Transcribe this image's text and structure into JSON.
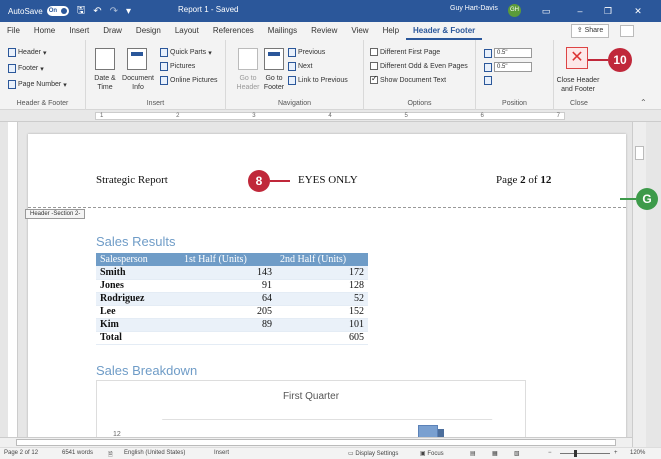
{
  "titlebar": {
    "autosave_label": "AutoSave",
    "autosave_state": "On",
    "doc_title": "Report 1 - Saved",
    "user_name": "Guy Hart-Davis",
    "user_initials": "GH",
    "brand_color": "#2b579a"
  },
  "tabs": [
    {
      "label": "File"
    },
    {
      "label": "Home"
    },
    {
      "label": "Insert"
    },
    {
      "label": "Draw"
    },
    {
      "label": "Design"
    },
    {
      "label": "Layout"
    },
    {
      "label": "References"
    },
    {
      "label": "Mailings"
    },
    {
      "label": "Review"
    },
    {
      "label": "View"
    },
    {
      "label": "Help"
    },
    {
      "label": "Header & Footer"
    }
  ],
  "active_tab": "Header & Footer",
  "share_label": "Share",
  "ribbon": {
    "header_footer": {
      "header": "Header",
      "footer": "Footer",
      "page_number": "Page Number",
      "group": "Header & Footer"
    },
    "insert": {
      "date_time": "Date &\nTime",
      "document_info": "Document\nInfo",
      "quick_parts": "Quick Parts",
      "pictures": "Pictures",
      "online_pictures": "Online Pictures",
      "group": "Insert"
    },
    "navigation": {
      "go_to_header": "Go to\nHeader",
      "go_to_footer": "Go to\nFooter",
      "previous": "Previous",
      "next": "Next",
      "link_to_previous": "Link to Previous",
      "group": "Navigation"
    },
    "options": {
      "different_first_page": "Different First Page",
      "different_odd_even": "Different Odd & Even Pages",
      "show_document_text": "Show Document Text",
      "show_document_text_checked": true,
      "group": "Options"
    },
    "position": {
      "header_from_top": "0.5\"",
      "footer_from_bottom": "0.5\"",
      "group": "Position"
    },
    "close": {
      "close_label": "Close Header\nand Footer",
      "group": "Close"
    }
  },
  "ruler_marks": [
    "1",
    "2",
    "3",
    "4",
    "5",
    "6",
    "7"
  ],
  "document": {
    "header_left": "Strategic Report",
    "header_center": "EYES ONLY",
    "header_page_prefix": "Page ",
    "header_page_current": "2",
    "header_page_mid": " of ",
    "header_page_total": "12",
    "header_section_tag": "Header -Section 2-",
    "sales_heading": "Sales Results",
    "table": {
      "headers": [
        "Salesperson",
        "1st Half (Units)",
        "2nd Half (Units)"
      ],
      "rows": [
        [
          "Smith",
          "143",
          "172"
        ],
        [
          "Jones",
          "91",
          "128"
        ],
        [
          "Rodriguez",
          "64",
          "52"
        ],
        [
          "Lee",
          "205",
          "152"
        ],
        [
          "Kim",
          "89",
          "101"
        ],
        [
          "Total",
          "",
          "605"
        ]
      ]
    },
    "breakdown_heading": "Sales Breakdown",
    "chart_title": "First Quarter",
    "chart_tick": "12"
  },
  "callouts": {
    "c8": "8",
    "c10": "10",
    "cG": "G",
    "red": "#c0283a",
    "green": "#3d9a4a"
  },
  "statusbar": {
    "page": "Page 2 of 12",
    "words": "6541 words",
    "language": "English (United States)",
    "mode": "Insert",
    "display_settings": "Display Settings",
    "focus": "Focus",
    "zoom": "120%"
  }
}
